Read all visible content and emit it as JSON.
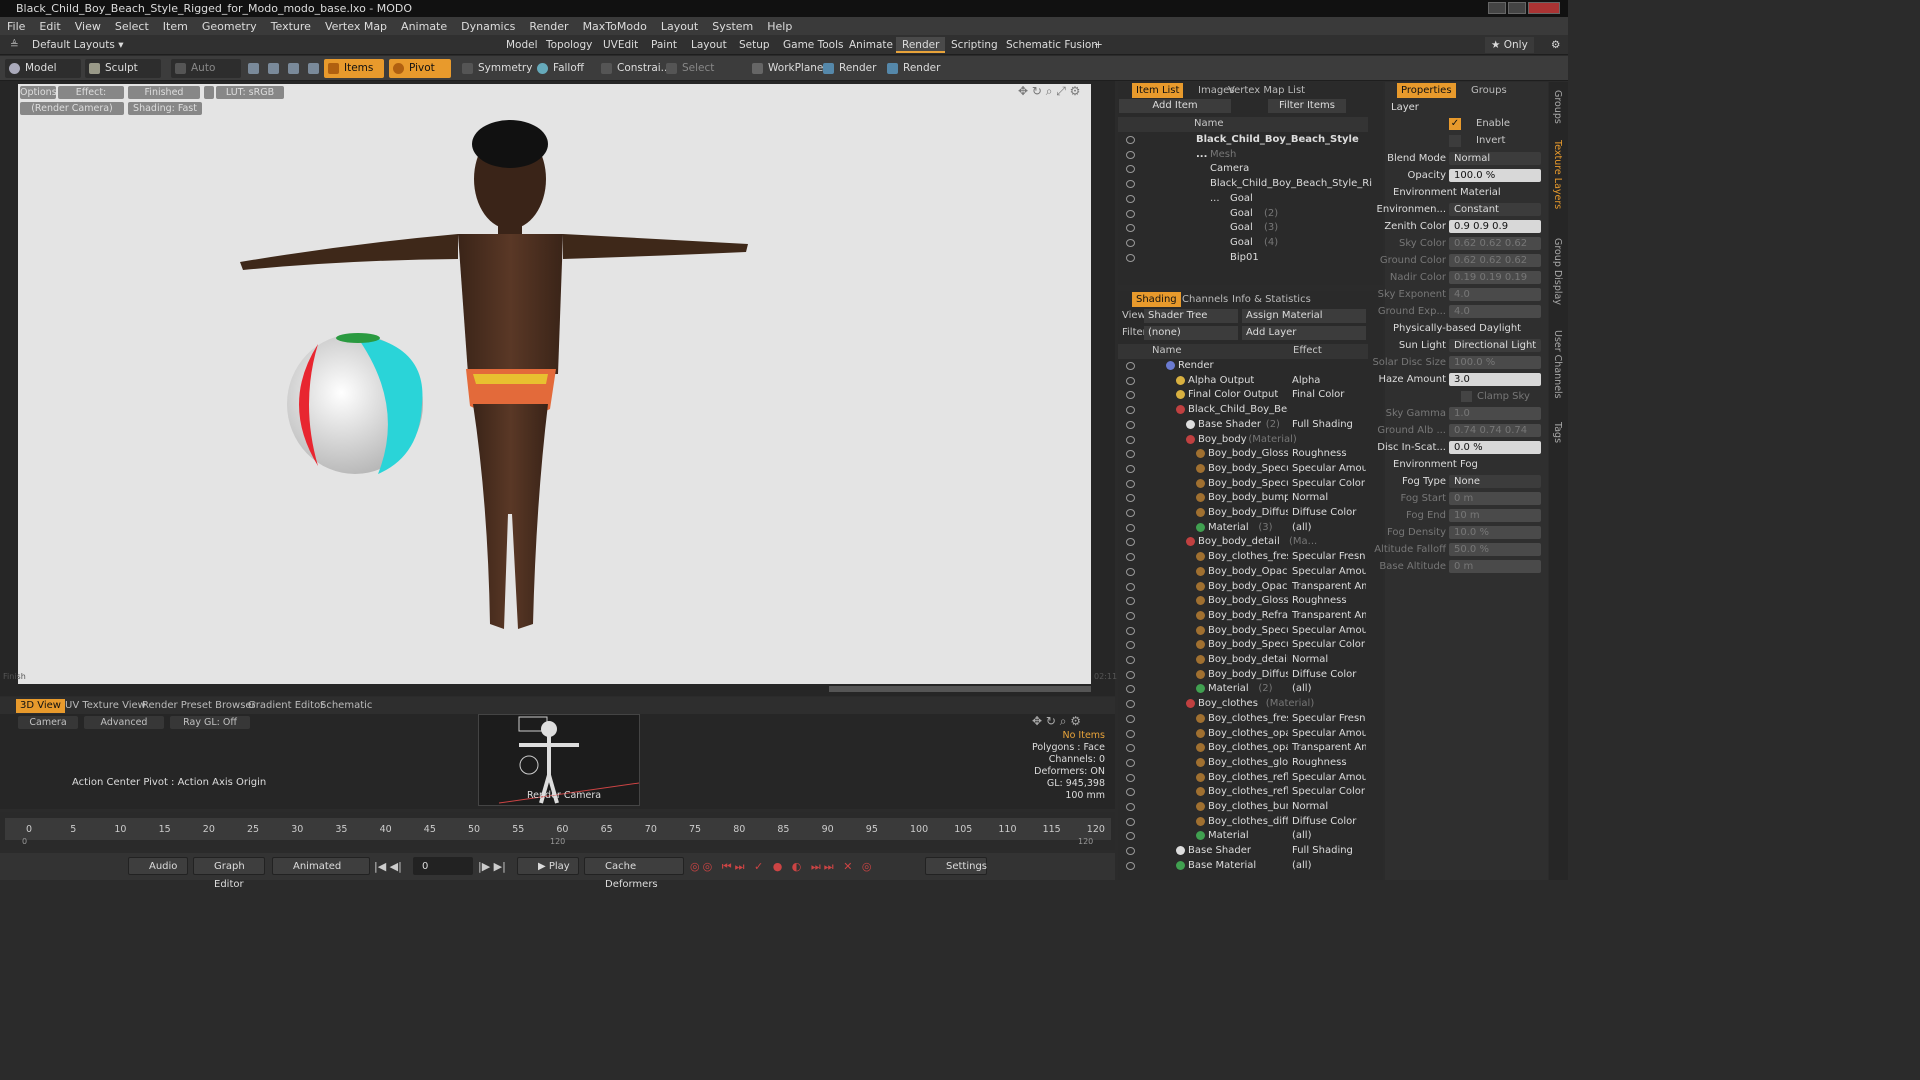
{
  "window": {
    "title": "Black_Child_Boy_Beach_Style_Rigged_for_Modo_modo_base.lxo - MODO"
  },
  "menu": [
    "File",
    "Edit",
    "View",
    "Select",
    "Item",
    "Geometry",
    "Texture",
    "Vertex Map",
    "Animate",
    "Dynamics",
    "Render",
    "MaxToModo",
    "Layout",
    "System",
    "Help"
  ],
  "layouts": {
    "current": "Default Layouts",
    "tabs": [
      "Model",
      "Topology",
      "UVEdit",
      "Paint",
      "Layout",
      "Setup",
      "Game Tools",
      "Animate",
      "Render",
      "Scripting",
      "Schematic Fusion"
    ],
    "active": "Render",
    "plus": "+",
    "only": "Only"
  },
  "toolbar": {
    "model": "Model",
    "sculpt": "Sculpt",
    "auto_select": "Auto Select",
    "items": "Items",
    "pivot": "Pivot",
    "symmetry": "Symmetry",
    "falloff": "Falloff",
    "constrain": "Constrai...",
    "select_through": "Select Through",
    "workplane": "WorkPlane",
    "render": "Render",
    "render_window": "Render Window"
  },
  "viewport": {
    "options": "Options",
    "effect": "Effect: (Shadi...",
    "finished": "Finished",
    "lut": "LUT: sRGB",
    "camera": "(Render Camera)",
    "shading": "Shading: Fast",
    "corner_left": "Finish",
    "corner_right": "02:11"
  },
  "bottom": {
    "tabs": [
      "3D View",
      "UV Texture View",
      "Render Preset Browser",
      "Gradient Editor",
      "Schematic"
    ],
    "active": "3D View",
    "camera": "Camera",
    "advanced": "Advanced",
    "raygl": "Ray GL: Off",
    "action_center": "Action Center Pivot : Action Axis Origin",
    "render_camera": "Render Camera",
    "stats": {
      "no_items": "No Items",
      "polygons": "Polygons : Face",
      "channels": "Channels: 0",
      "deformers": "Deformers: ON",
      "gl": "GL: 945,398",
      "scale": "100 mm"
    }
  },
  "timeline": {
    "ticks": [
      "0",
      "5",
      "10",
      "15",
      "20",
      "25",
      "30",
      "35",
      "40",
      "45",
      "50",
      "55",
      "60",
      "65",
      "70",
      "75",
      "80",
      "85",
      "90",
      "95",
      "100",
      "105",
      "110",
      "115",
      "120"
    ],
    "sub_left": "0",
    "sub_mid": "120",
    "sub_right": "120"
  },
  "transport": {
    "audio": "Audio",
    "graph_editor": "Graph Editor",
    "animated": "Animated",
    "frame": "0",
    "play": "Play",
    "cache_deformers": "Cache Deformers",
    "settings": "Settings"
  },
  "item_list": {
    "tabs": [
      "Item List",
      "Images",
      "Vertex Map List"
    ],
    "add_item": "Add Item",
    "filter": "Filter Items",
    "col_name": "Name",
    "rows": [
      {
        "label": "Black_Child_Boy_Beach_Style ...",
        "indent": 78,
        "bold": true
      },
      {
        "label": "Mesh",
        "indent": 92,
        "dim": true
      },
      {
        "label": "Camera",
        "indent": 92
      },
      {
        "label": "Black_Child_Boy_Beach_Style_Ri ...",
        "indent": 92
      },
      {
        "label": "Goal",
        "indent": 112
      },
      {
        "label": "Goal",
        "suffix": "(2)",
        "indent": 112
      },
      {
        "label": "Goal",
        "suffix": "(3)",
        "indent": 112
      },
      {
        "label": "Goal",
        "suffix": "(4)",
        "indent": 112
      },
      {
        "label": "Bip01",
        "indent": 112
      }
    ]
  },
  "shading": {
    "tabs": [
      "Shading",
      "Channels",
      "Info & Statistics"
    ],
    "view_label": "View",
    "view_value": "Shader Tree",
    "assign": "Assign Material",
    "filter_label": "Filter",
    "filter_value": "(none)",
    "add_layer": "Add Layer",
    "col_name": "Name",
    "col_effect": "Effect",
    "rows": [
      {
        "name": "Render",
        "effect": "",
        "indent": 44,
        "ball": "#6a7ad0"
      },
      {
        "name": "Alpha Output",
        "effect": "Alpha",
        "indent": 54,
        "ball": "#d8b040"
      },
      {
        "name": "Final Color Output",
        "effect": "Final Color",
        "indent": 54,
        "ball": "#d8b040"
      },
      {
        "name": "Black_Child_Boy_Beach ...",
        "effect": "",
        "indent": 54,
        "ball": "#c04040"
      },
      {
        "name": "Base Shader",
        "suffix": "(2)",
        "effect": "Full Shading",
        "indent": 64,
        "ball": "#dddddd"
      },
      {
        "name": "Boy_body",
        "suffix": "(Material)",
        "effect": "",
        "indent": 64,
        "ball": "#c04040"
      },
      {
        "name": "Boy_body_Glossin ...",
        "effect": "Roughness",
        "indent": 74,
        "ball": "#a07030"
      },
      {
        "name": "Boy_body_Specula...",
        "effect": "Specular Amount",
        "indent": 74,
        "ball": "#a07030"
      },
      {
        "name": "Boy_body_Specula...",
        "effect": "Specular Color",
        "indent": 74,
        "ball": "#a07030"
      },
      {
        "name": "Boy_body_bump_ ...",
        "effect": "Normal",
        "indent": 74,
        "ball": "#a07030"
      },
      {
        "name": "Boy_body_Diffuse ...",
        "effect": "Diffuse Color",
        "indent": 74,
        "ball": "#a07030"
      },
      {
        "name": "Material",
        "suffix": "(3)",
        "effect": "(all)",
        "indent": 74,
        "ball": "#40a050"
      },
      {
        "name": "Boy_body_detail",
        "suffix": "(Ma...",
        "effect": "",
        "indent": 64,
        "ball": "#c04040"
      },
      {
        "name": "Boy_clothes_fresn ...",
        "effect": "Specular Fresnel",
        "indent": 74,
        "ball": "#a07030"
      },
      {
        "name": "Boy_body_Opacity...",
        "effect": "Specular Amount",
        "indent": 74,
        "ball": "#a07030"
      },
      {
        "name": "Boy_body_Opacity...",
        "effect": "Transparent Am...",
        "indent": 74,
        "ball": "#a07030"
      },
      {
        "name": "Boy_body_Glossin ...",
        "effect": "Roughness",
        "indent": 74,
        "ball": "#a07030"
      },
      {
        "name": "Boy_body_Refract...",
        "effect": "Transparent Am...",
        "indent": 74,
        "ball": "#a07030"
      },
      {
        "name": "Boy_body_Specula...",
        "effect": "Specular Amount",
        "indent": 74,
        "ball": "#a07030"
      },
      {
        "name": "Boy_body_Specula...",
        "effect": "Specular Color",
        "indent": 74,
        "ball": "#a07030"
      },
      {
        "name": "Boy_body_detail_ ...",
        "effect": "Normal",
        "indent": 74,
        "ball": "#a07030"
      },
      {
        "name": "Boy_body_Diffuse ...",
        "effect": "Diffuse Color",
        "indent": 74,
        "ball": "#a07030"
      },
      {
        "name": "Material",
        "suffix": "(2)",
        "effect": "(all)",
        "indent": 74,
        "ball": "#40a050"
      },
      {
        "name": "Boy_clothes",
        "suffix": "(Material)",
        "effect": "",
        "indent": 64,
        "ball": "#c04040"
      },
      {
        "name": "Boy_clothes_fresn ...",
        "effect": "Specular Fresnel",
        "indent": 74,
        "ball": "#a07030"
      },
      {
        "name": "Boy_clothes_opacl ...",
        "effect": "Specular Amount",
        "indent": 74,
        "ball": "#a07030"
      },
      {
        "name": "Boy_clothes_opacl ...",
        "effect": "Transparent Am...",
        "indent": 74,
        "ball": "#a07030"
      },
      {
        "name": "Boy_clothes_glossi...",
        "effect": "Roughness",
        "indent": 74,
        "ball": "#a07030"
      },
      {
        "name": "Boy_clothes_reflec...",
        "effect": "Specular Amount",
        "indent": 74,
        "ball": "#a07030"
      },
      {
        "name": "Boy_clothes_reflec...",
        "effect": "Specular Color",
        "indent": 74,
        "ball": "#a07030"
      },
      {
        "name": "Boy_clothes_bump...",
        "effect": "Normal",
        "indent": 74,
        "ball": "#a07030"
      },
      {
        "name": "Boy_clothes_diffus...",
        "effect": "Diffuse Color",
        "indent": 74,
        "ball": "#a07030"
      },
      {
        "name": "Material",
        "effect": "(all)",
        "indent": 74,
        "ball": "#40a050"
      },
      {
        "name": "Base Shader",
        "effect": "Full Shading",
        "indent": 54,
        "ball": "#dddddd"
      },
      {
        "name": "Base Material",
        "effect": "(all)",
        "indent": 54,
        "ball": "#40a050"
      }
    ]
  },
  "properties": {
    "tabs": [
      "Properties",
      "Groups"
    ],
    "layer": "Layer",
    "enable": "Enable",
    "invert": "Invert",
    "rows": [
      {
        "label": "Blend Mode",
        "value": "Normal",
        "kind": "drop"
      },
      {
        "label": "Opacity",
        "value": "100.0 %",
        "kind": "val"
      },
      {
        "label": "Environment Material",
        "kind": "section"
      },
      {
        "label": "Environmen...",
        "value": "Constant",
        "kind": "drop"
      },
      {
        "label": "Zenith Color",
        "value": "0.9   0.9   0.9",
        "kind": "val"
      },
      {
        "label": "Sky Color",
        "value": "0.62  0.62  0.62",
        "kind": "dim"
      },
      {
        "label": "Ground Color",
        "value": "0.62  0.62  0.62",
        "kind": "dim"
      },
      {
        "label": "Nadir Color",
        "value": "0.19  0.19  0.19",
        "kind": "dim"
      },
      {
        "label": "Sky Exponent",
        "value": "4.0",
        "kind": "dim"
      },
      {
        "label": "Ground Exp...",
        "value": "4.0",
        "kind": "dim"
      },
      {
        "label": "Physically-based Daylight",
        "kind": "section"
      },
      {
        "label": "Sun Light",
        "value": "Directional Light",
        "kind": "drop"
      },
      {
        "label": "Solar Disc Size",
        "value": "100.0 %",
        "kind": "dim"
      },
      {
        "label": "Haze Amount",
        "value": "3.0",
        "kind": "val"
      },
      {
        "label": "Clamp Sky Brig...",
        "kind": "check"
      },
      {
        "label": "Sky Gamma",
        "value": "1.0",
        "kind": "dim"
      },
      {
        "label": "Ground Alb ...",
        "value": "0.74  0.74  0.74",
        "kind": "dim"
      },
      {
        "label": "Disc In-Scat...",
        "value": "0.0 %",
        "kind": "val"
      },
      {
        "label": "Environment Fog",
        "kind": "section"
      },
      {
        "label": "Fog Type",
        "value": "None",
        "kind": "drop"
      },
      {
        "label": "Fog Start",
        "value": "0 m",
        "kind": "dim"
      },
      {
        "label": "Fog End",
        "value": "10 m",
        "kind": "dim"
      },
      {
        "label": "Fog Density",
        "value": "10.0 %",
        "kind": "dim"
      },
      {
        "label": "Altitude Falloff",
        "value": "50.0 %",
        "kind": "dim"
      },
      {
        "label": "Base Altitude",
        "value": "0 m",
        "kind": "dim"
      }
    ]
  },
  "side_tabs": [
    "Groups",
    "Texture Layers",
    "Group Display",
    "User Channels",
    "Tags"
  ],
  "colors": {
    "accent": "#e89a2c",
    "viewport_bg": "#e4e4e4",
    "panel_bg": "#2a2a2a"
  }
}
